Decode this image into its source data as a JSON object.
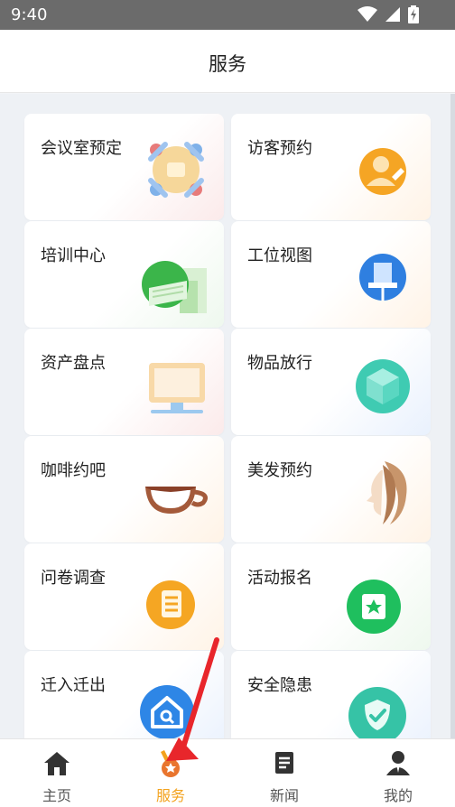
{
  "status_bar": {
    "time": "9:40",
    "icons": [
      "wifi-icon",
      "signal-icon",
      "battery-charging-icon"
    ]
  },
  "header": {
    "title": "服务"
  },
  "services": [
    {
      "label": "会议室预定",
      "icon": "meeting-people-icon"
    },
    {
      "label": "访客预约",
      "icon": "visitor-avatar-icon"
    },
    {
      "label": "培训中心",
      "icon": "training-books-icon"
    },
    {
      "label": "工位视图",
      "icon": "workstation-pin-icon"
    },
    {
      "label": "资产盘点",
      "icon": "monitor-icon"
    },
    {
      "label": "物品放行",
      "icon": "cube-icon"
    },
    {
      "label": "咖啡约吧",
      "icon": "coffee-cup-icon"
    },
    {
      "label": "美发预约",
      "icon": "hair-profile-icon"
    },
    {
      "label": "问卷调查",
      "icon": "scroll-icon"
    },
    {
      "label": "活动报名",
      "icon": "star-badge-icon"
    },
    {
      "label": "迁入迁出",
      "icon": "house-search-icon"
    },
    {
      "label": "安全隐患",
      "icon": "shield-check-icon"
    }
  ],
  "tabs": [
    {
      "label": "主页",
      "icon": "home-icon",
      "active": false
    },
    {
      "label": "服务",
      "icon": "medal-icon",
      "active": true
    },
    {
      "label": "新闻",
      "icon": "news-icon",
      "active": false
    },
    {
      "label": "我的",
      "icon": "profile-icon",
      "active": false
    }
  ],
  "colors": {
    "accent": "#f3a21c",
    "annotation_arrow": "#e8262b",
    "status_bar": "#6b6b6b"
  }
}
